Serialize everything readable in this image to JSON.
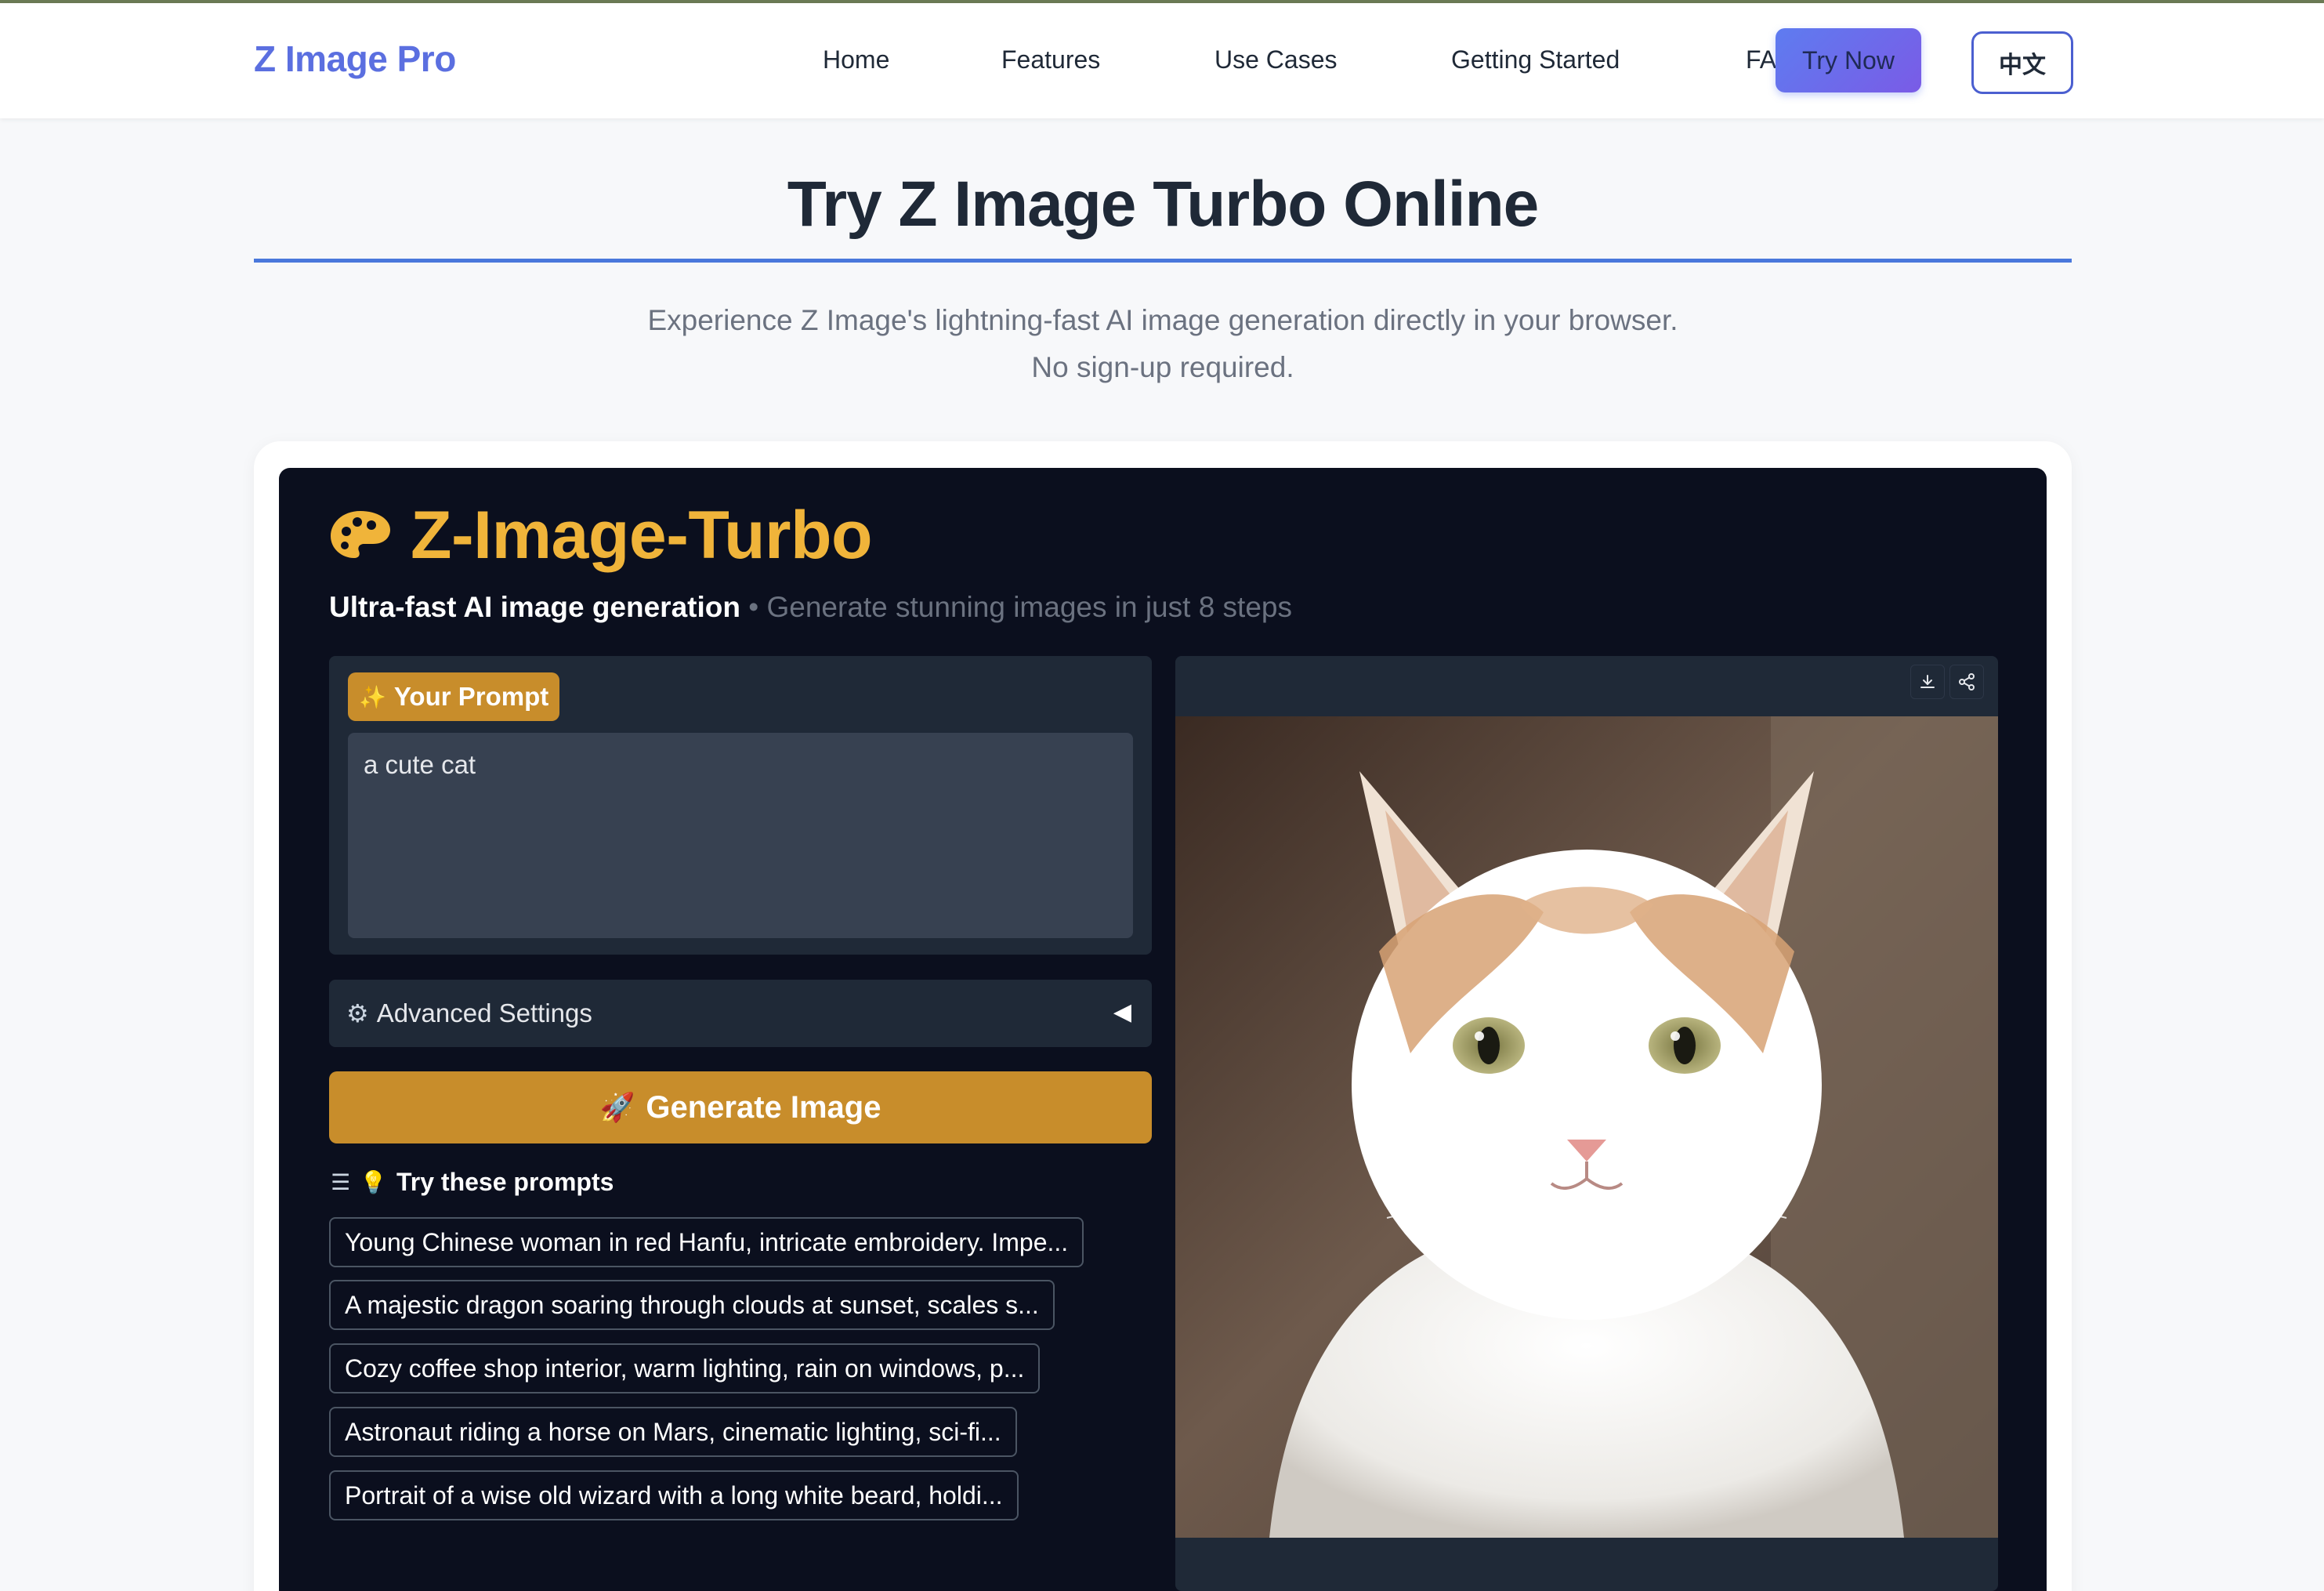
{
  "nav": {
    "brand": "Z Image Pro",
    "links": [
      "Home",
      "Features",
      "Use Cases",
      "Getting Started",
      "FAQ"
    ],
    "try_now": "Try Now",
    "lang": "中文"
  },
  "hero": {
    "title": "Try Z Image Turbo Online",
    "subtitle_line1": "Experience Z Image's lightning-fast AI image generation directly in your browser.",
    "subtitle_line2": "No sign-up required."
  },
  "app": {
    "title": "Z-Image-Turbo",
    "tagline_strong": "Ultra-fast AI image generation",
    "tagline_muted": " • Generate stunning images in just 8 steps",
    "prompt_label": "Your Prompt",
    "prompt_value": "a cute cat",
    "advanced_label": "Advanced Settings",
    "generate_label": "Generate Image",
    "examples_label": "Try these prompts",
    "examples": [
      "Young Chinese woman in red Hanfu, intricate embroidery. Impe...",
      "A majestic dragon soaring through clouds at sunset, scales s...",
      "Cozy coffee shop interior, warm lighting, rain on windows, p...",
      "Astronaut riding a horse on Mars, cinematic lighting, sci-fi...",
      "Portrait of a wise old wizard with a long white beard, holdi..."
    ]
  },
  "colors": {
    "accent_gold": "#c88d2b",
    "title_gold": "#f0b43a",
    "brand_blue": "#5b6fe0",
    "panel_dark": "#0b0f1e"
  },
  "icons": [
    "palette-icon",
    "sparkle-icon",
    "gear-icon",
    "caret-left-icon",
    "rocket-icon",
    "list-icon",
    "lightbulb-icon",
    "download-icon",
    "share-icon"
  ]
}
